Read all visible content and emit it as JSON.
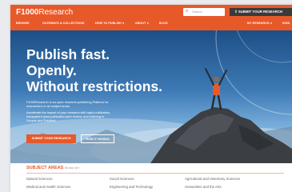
{
  "header": {
    "logo": {
      "bold": "F1000",
      "rest": "Research"
    },
    "search_placeholder": "Search",
    "submit_label": "SUBMIT YOUR RESEARCH",
    "nav_left": [
      "BROWSE",
      "GATEWAYS & COLLECTIONS",
      "HOW TO PUBLISH ∨",
      "ABOUT ∨",
      "BLOG"
    ],
    "nav_right": [
      "MY RESEARCH ∨",
      "SIGN"
    ]
  },
  "hero": {
    "heading": [
      "Publish fast.",
      "Openly.",
      "Without restrictions."
    ],
    "description_1": "F1000Research is an open research publishing Platform for researchers in all subject areas.",
    "description_2": "Accelerate the impact of your research with rapid publication, transparent post-publication peer review, and indexing in Scopus and PubMed.",
    "primary_button": "SUBMIT YOUR RESEARCH",
    "secondary_button": "HOW IT WORKS"
  },
  "subjects": {
    "title": "SUBJECT AREAS",
    "link": "Browse all >",
    "items": [
      "Natural Sciences",
      "Social Sciences",
      "Agricultural and Veterinary Sciences",
      "Medical and Health Sciences",
      "Engineering and Technology",
      "Humanities and the Arts"
    ]
  },
  "colors": {
    "brand": "#e8592a",
    "dark": "#3a3a3a"
  }
}
